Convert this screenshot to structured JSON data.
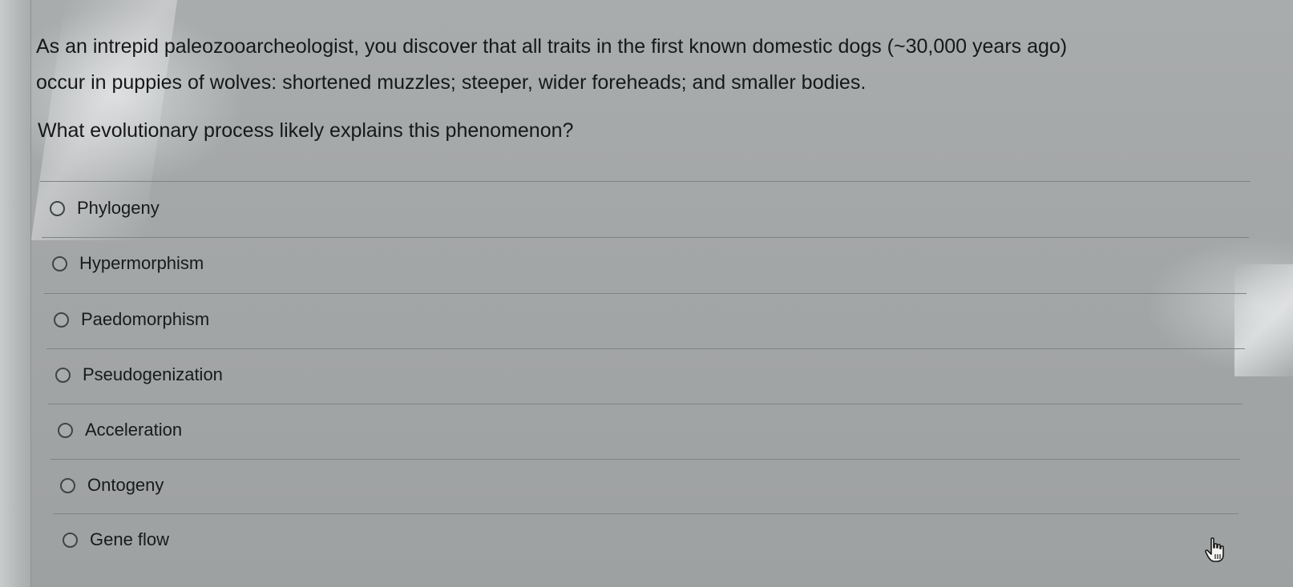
{
  "question": {
    "line1": "As an intrepid paleozooarcheologist, you discover that all traits in the first known domestic dogs (~30,000 years ago)",
    "line2": "occur in puppies of wolves: shortened muzzles; steeper, wider foreheads; and smaller bodies.",
    "prompt": "What evolutionary process likely explains this phenomenon?"
  },
  "options": [
    {
      "label": "Phylogeny"
    },
    {
      "label": "Hypermorphism"
    },
    {
      "label": "Paedomorphism"
    },
    {
      "label": "Pseudogenization"
    },
    {
      "label": "Acceleration"
    },
    {
      "label": "Ontogeny"
    },
    {
      "label": "Gene flow"
    }
  ],
  "icons": {
    "radio": "radio-button-icon",
    "cursor": "hand-pointer-icon"
  }
}
